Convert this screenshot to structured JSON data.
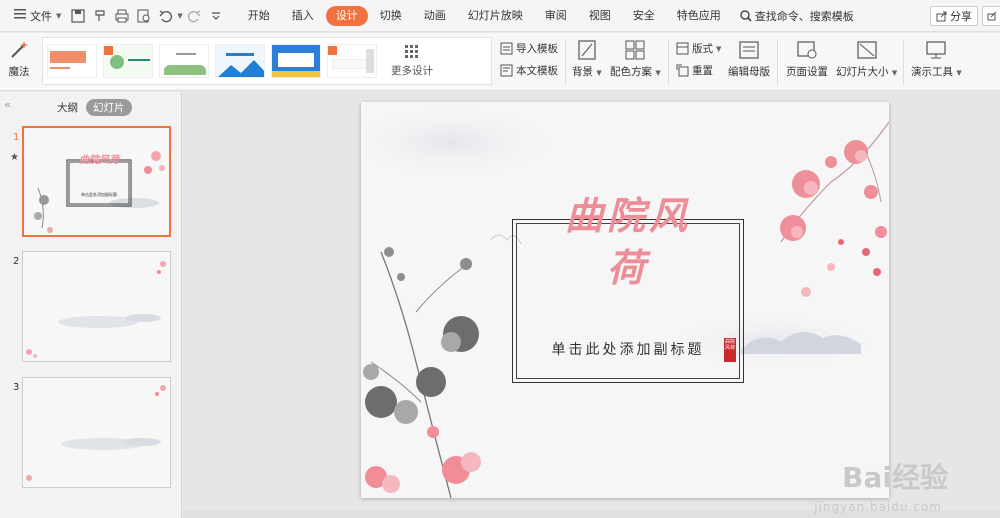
{
  "menu": {
    "file": "文件"
  },
  "tabs": [
    "开始",
    "插入",
    "设计",
    "切换",
    "动画",
    "幻灯片放映",
    "审阅",
    "视图",
    "安全",
    "特色应用"
  ],
  "active_tab": "设计",
  "search": {
    "label": "查找命令、搜索模板"
  },
  "share": {
    "label": "分享"
  },
  "ribbon": {
    "magic": "魔法",
    "more_designs": "更多设计",
    "import_template": "导入模板",
    "text_template": "本文模板",
    "background": "背景",
    "color_scheme": "配色方案",
    "layout": "版式",
    "reset": "重置",
    "edit_master": "编辑母版",
    "page_setup": "页面设置",
    "slide_size": "幻灯片大小",
    "presentation_tools": "演示工具"
  },
  "left_panel": {
    "tab_outline": "大纲",
    "tab_slides": "幻灯片",
    "thumbs": [
      {
        "num": "1"
      },
      {
        "num": "2"
      },
      {
        "num": "3"
      }
    ],
    "thumb1_title": "曲院风荷",
    "thumb1_subtitle": "单击此处添加副标题"
  },
  "slide": {
    "title_line1": "曲院风",
    "title_line2": "荷",
    "subtitle": "单击此处添加副标题",
    "seal_text": "曲院风荷"
  },
  "watermark": {
    "text": "Bai经验",
    "url": "jingyan.baidu.com"
  },
  "colors": {
    "accent": "#f0733f",
    "title_pink": "#ec8d98",
    "seal_red": "#c8282e"
  }
}
